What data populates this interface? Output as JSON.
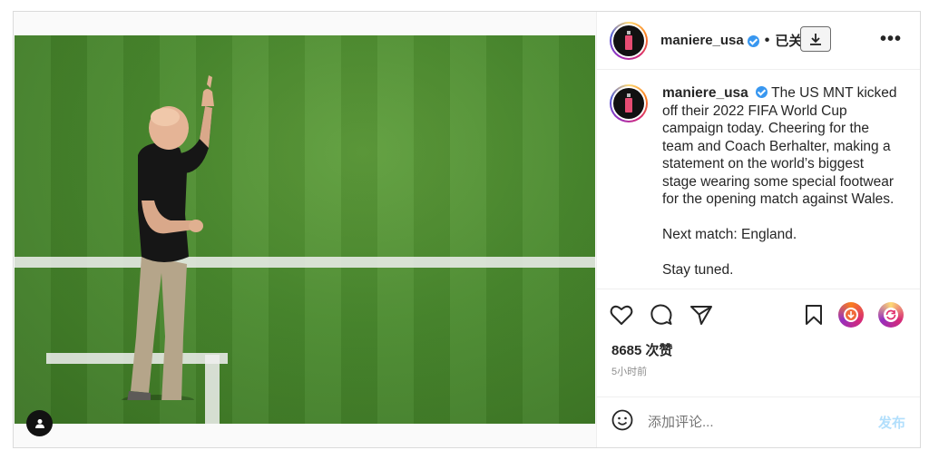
{
  "post": {
    "username": "maniere_usa",
    "follow_status": "已关注",
    "caption_paragraphs": [
      "The US MNT kicked off their 2022 FIFA World Cup campaign today. Cheering for the team and Coach Berhalter, making a statement on the world’s biggest stage wearing some special footwear for the opening match against Wales.",
      "Next match: England.",
      "Stay tuned."
    ],
    "likes": "8685 次赞",
    "time_ago": "5小时前"
  },
  "comment": {
    "placeholder": "添加评论...",
    "post_label": "发布"
  },
  "icons": {
    "header": [
      "verified-badge-icon",
      "download-icon",
      "more-options-icon"
    ],
    "actions": [
      "heart-icon",
      "comment-icon",
      "share-icon",
      "bookmark-icon",
      "extension-download-icon",
      "extension-repost-icon"
    ],
    "comment": [
      "emoji-icon"
    ],
    "media": [
      "user-tag-icon"
    ]
  },
  "colors": {
    "verified": "#3897f0",
    "post_button": "#b2dffc",
    "pitch_green": "#4a8a2e"
  }
}
